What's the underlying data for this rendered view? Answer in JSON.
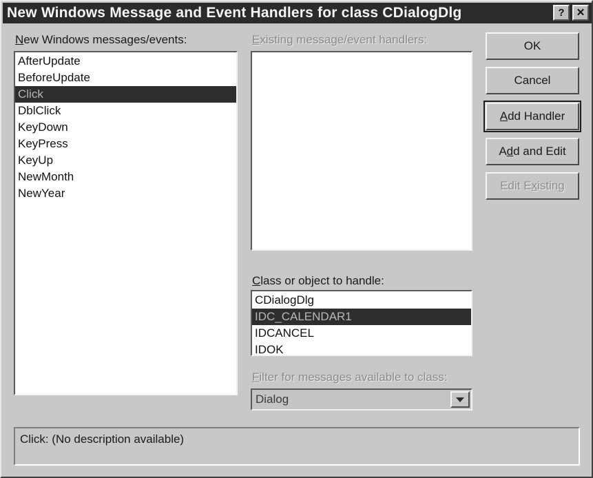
{
  "window": {
    "title": "New Windows Message and Event Handlers for class CDialogDlg",
    "help_button": "?",
    "close_button": "✕",
    "help_icon_name": "help-icon",
    "close_icon_name": "close-icon"
  },
  "messages_panel": {
    "label_prefix": "N",
    "label_rest": "ew Windows messages/events:",
    "items": [
      {
        "label": "AfterUpdate",
        "selected": false
      },
      {
        "label": "BeforeUpdate",
        "selected": false
      },
      {
        "label": "Click",
        "selected": true
      },
      {
        "label": "DblClick",
        "selected": false
      },
      {
        "label": "KeyDown",
        "selected": false
      },
      {
        "label": "KeyPress",
        "selected": false
      },
      {
        "label": "KeyUp",
        "selected": false
      },
      {
        "label": "NewMonth",
        "selected": false
      },
      {
        "label": "NewYear",
        "selected": false
      }
    ]
  },
  "handlers_panel": {
    "label_prefix": "E",
    "label_rest": "xisting message/event handlers:",
    "disabled": true,
    "items": []
  },
  "class_panel": {
    "label_prefix": "C",
    "label_rest": "lass or object to handle:",
    "items": [
      {
        "label": "CDialogDlg",
        "selected": false
      },
      {
        "label": "IDC_CALENDAR1",
        "selected": true
      },
      {
        "label": "IDCANCEL",
        "selected": false
      },
      {
        "label": "IDOK",
        "selected": false
      }
    ]
  },
  "filter_panel": {
    "label_prefix": "F",
    "label_rest": "ilter for messages available to class:",
    "value": "Dialog",
    "disabled": true,
    "arrow_icon_name": "chevron-down-icon"
  },
  "buttons": [
    {
      "prefix": "",
      "acc": "",
      "rest": "OK",
      "state": "normal"
    },
    {
      "prefix": "",
      "acc": "",
      "rest": "Cancel",
      "state": "normal"
    },
    {
      "prefix": "",
      "acc": "A",
      "rest": "dd Handler",
      "state": "default"
    },
    {
      "prefix": "A",
      "acc": "d",
      "rest": "d and Edit",
      "state": "normal"
    },
    {
      "prefix": "Edit E",
      "acc": "x",
      "rest": "isting",
      "state": "disabled"
    }
  ],
  "status": {
    "text": "Click: (No description available)"
  },
  "colors": {
    "dialog_face": "#c8c8c8",
    "titlebar": "#2b2b2b",
    "selection": "#2e2e2e",
    "selection_text": "#b8b8b8",
    "listbox_bg": "#ffffff",
    "disabled_text": "#8a8a8a"
  }
}
